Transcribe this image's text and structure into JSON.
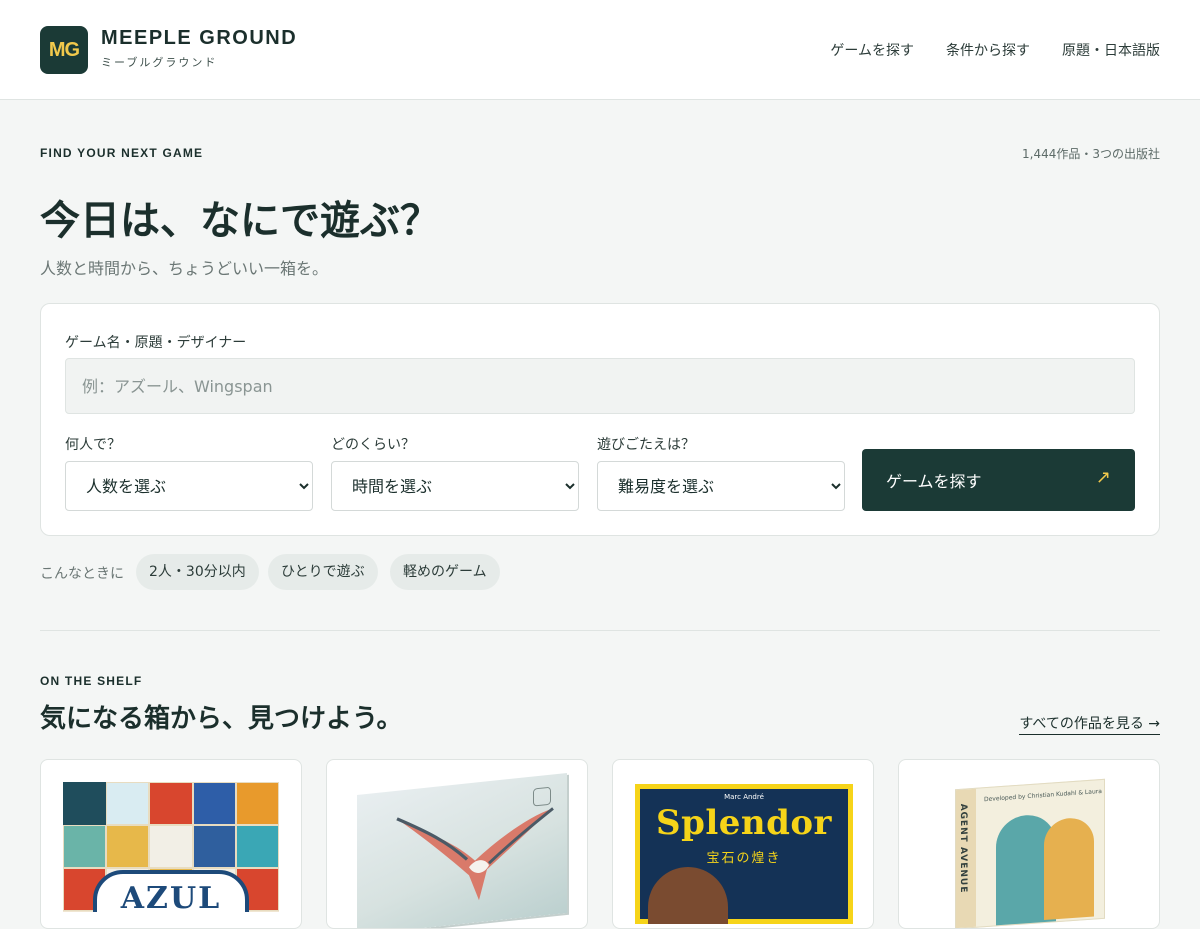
{
  "header": {
    "logo_mark": "MG",
    "brand_name": "MEEPLE GROUND",
    "brand_sub": "ミーブルグラウンド",
    "nav": [
      "ゲームを探す",
      "条件から探す",
      "原題・日本語版"
    ]
  },
  "hero": {
    "eyebrow": "FIND YOUR NEXT GAME",
    "stats": "1,444作品・3つの出版社",
    "title": "今日は、なにで遊ぶ？",
    "subtitle": "人数と時間から、ちょうどいい一箱を。"
  },
  "search": {
    "query_label": "ゲーム名・原題・デザイナー",
    "query_placeholder": "例：アズール、Wingspan",
    "players_label": "何人で？",
    "players_value": "人数を選ぶ",
    "time_label": "どのくらい？",
    "time_value": "時間を選ぶ",
    "difficulty_label": "遊びごたえは？",
    "difficulty_value": "難易度を選ぶ",
    "submit_label": "ゲームを探す",
    "submit_icon": "arrow-up-right-icon"
  },
  "quick": {
    "label": "こんなときに",
    "chips": [
      "2人・30分以内",
      "ひとりで遊ぶ",
      "軽めのゲーム"
    ]
  },
  "shelf": {
    "eyebrow": "ON THE SHELF",
    "title": "気になる箱から、見つけよう。",
    "see_all": "すべての作品を見る →",
    "games": [
      {
        "cover_title": "AZUL",
        "cover_icon": "azul-tile-box-cover"
      },
      {
        "cover_icon": "wingspan-bird-box-cover"
      },
      {
        "cover_author": "Marc André",
        "cover_title": "Splendor",
        "cover_subtitle": "宝石の煌き",
        "cover_icon": "splendor-box-cover"
      },
      {
        "cover_credit": "Developed by Christian Kudahl & Laura Kudahl",
        "cover_title": "AGENT AVENUE",
        "cover_icon": "agent-avenue-box-cover"
      }
    ]
  },
  "colors": {
    "background": "#f4f6f5",
    "primary": "#1b3a36",
    "accent": "#f2c94c",
    "chip_bg": "#e6ebe9"
  }
}
